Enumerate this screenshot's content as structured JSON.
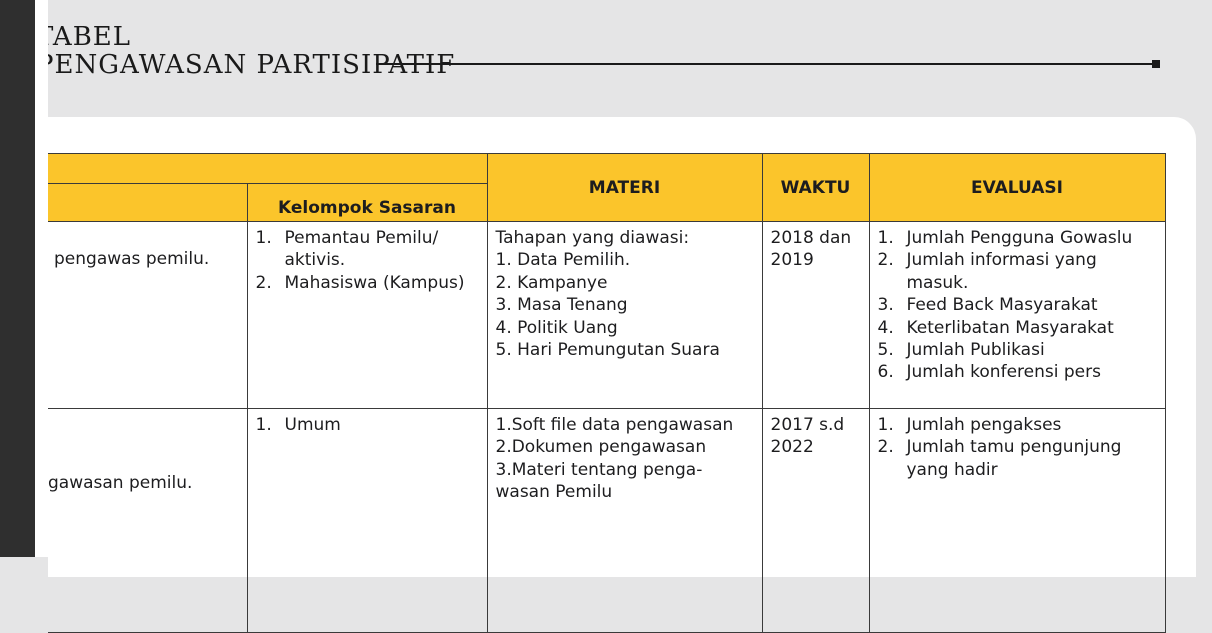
{
  "title": {
    "line1": "TABEL",
    "line2": "PENGAWASAN PARTISIPATIF"
  },
  "table": {
    "headers": {
      "col0": "",
      "sub_label": "Kelompok Sasaran",
      "materi": "MATERI",
      "waktu": "WAKTU",
      "evaluasi": "EVALUASI"
    },
    "rows": [
      {
        "tujuan": "pengawas pemilu.",
        "sasaran": [
          {
            "n": "1.",
            "t": "Pemantau Pemilu/ aktivis."
          },
          {
            "n": "2.",
            "t": "Mahasiswa (Kampus)"
          }
        ],
        "materi": [
          "Tahapan yang diawasi:",
          "1. Data Pemilih.",
          "2. Kampanye",
          "3. Masa Tenang",
          "4. Politik Uang",
          "5. Hari Pemungutan Suara"
        ],
        "waktu": "2018 dan 2019",
        "evaluasi": [
          {
            "n": "1.",
            "t": "Jumlah Pengguna Gowaslu"
          },
          {
            "n": "2.",
            "t": "Jumlah informasi yang masuk."
          },
          {
            "n": "3.",
            "t": "Feed Back Masyarakat"
          },
          {
            "n": "4.",
            "t": "Keterlibatan Masyarakat"
          },
          {
            "n": "5.",
            "t": "Jumlah Publikasi"
          },
          {
            "n": "6.",
            "t": "Jumlah konferensi pers"
          }
        ]
      },
      {
        "tujuan": "gawasan pemilu.",
        "sasaran": [
          {
            "n": "1.",
            "t": "Umum"
          }
        ],
        "materi": [
          "1.Soft file data pengawasan",
          "2.Dokumen pengawasan",
          "3.Materi tentang penga-",
          "wasan Pemilu"
        ],
        "waktu": "2017 s.d 2022",
        "evaluasi": [
          {
            "n": "1.",
            "t": "Jumlah pengakses"
          },
          {
            "n": "2.",
            "t": "Jumlah tamu pengunjung yang hadir"
          }
        ]
      }
    ]
  }
}
